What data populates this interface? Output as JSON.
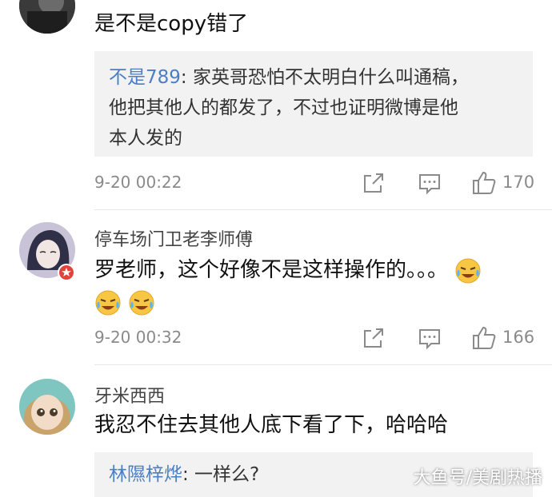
{
  "comments": [
    {
      "text": "是不是copy错了",
      "quote": {
        "name": "不是789",
        "text": ": 家英哥恐怕不太明白什么叫通稿，",
        "line2": "他把其他人的都发了，不过也证明微博是他",
        "line3": "本人发的"
      },
      "time": "9-20 00:22",
      "likes": "170"
    },
    {
      "username": "停车场门卫老李师傅",
      "text": "罗老师，这个好像不是这样操作的。。。",
      "time": "9-20 00:32",
      "likes": "166"
    },
    {
      "username": "牙米西西",
      "text": "我忍不住去其他人底下看了下，哈哈哈",
      "quote": {
        "name": "林隰梓烨",
        "text": ": 一样么?"
      }
    }
  ],
  "watermark": "大鱼号/美剧热播",
  "icons": [
    "share-icon",
    "comment-icon",
    "like-icon",
    "laugh-cry-emoji",
    "verified-badge-icon"
  ],
  "colors": {
    "link": "#4a7fc4",
    "muted": "#8a8a8a",
    "quote_bg": "#f2f2f2",
    "badge": "#e0443b"
  }
}
